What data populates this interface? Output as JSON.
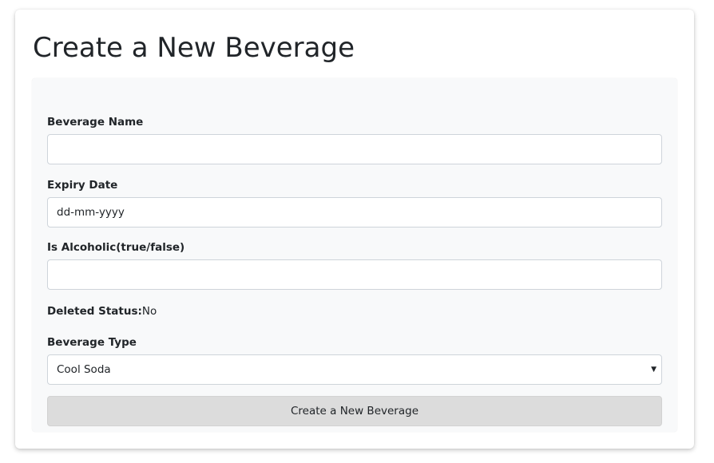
{
  "page": {
    "title": "Create a New Beverage"
  },
  "form": {
    "beverage_name": {
      "label": "Beverage Name",
      "value": ""
    },
    "expiry_date": {
      "label": "Expiry Date",
      "placeholder": "dd-mm-yyyy"
    },
    "is_alcoholic": {
      "label": "Is Alcoholic(true/false)",
      "value": ""
    },
    "deleted_status": {
      "label": "Deleted Status:",
      "value": "No"
    },
    "beverage_type": {
      "label": "Beverage Type",
      "selected": "Cool Soda",
      "caret": "▼"
    },
    "submit_label": "Create a New Beverage"
  },
  "colors": {
    "panel_background": "#f8f9fa",
    "input_border": "#ced4da",
    "button_background": "#dcdcdc",
    "text": "#212529"
  }
}
